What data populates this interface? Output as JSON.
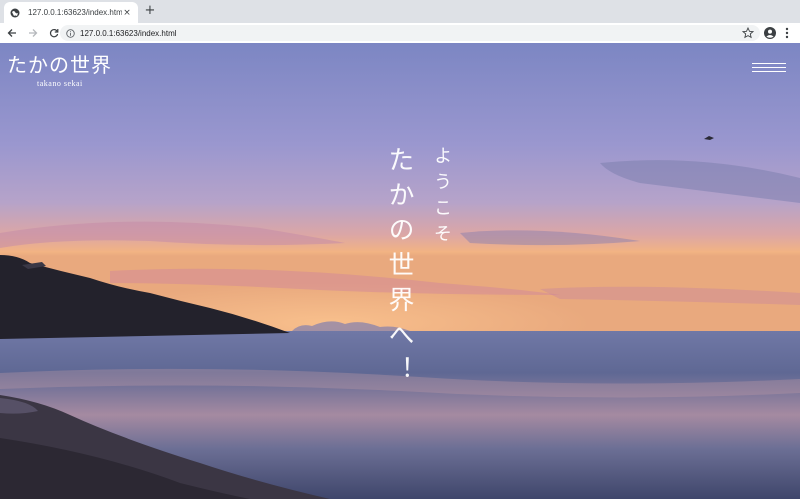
{
  "browser": {
    "tab_title": "127.0.0.1:63623/index.html",
    "tab_close": "×",
    "new_tab": "+",
    "url": "127.0.0.1:63623/index.html"
  },
  "site": {
    "logo_main": "たかの世界",
    "logo_sub": "takano sekai"
  },
  "hero": {
    "welcome": "ようこそ",
    "main_line": "たかの世界へ！"
  },
  "icons": {
    "tab": "globe-icon",
    "back": "back-arrow-icon",
    "forward": "forward-arrow-icon",
    "reload": "reload-icon",
    "site_info": "info-icon",
    "bookmark": "star-icon",
    "profile": "avatar-icon",
    "browser_menu": "kebab-menu-icon",
    "site_menu": "hamburger-menu-icon"
  },
  "colors": {
    "sky_top": "#7d86c2",
    "sky_mid": "#a79ccc",
    "horizon": "#f0b07a",
    "sea": "#4f5a86",
    "text": "#ffffff"
  }
}
